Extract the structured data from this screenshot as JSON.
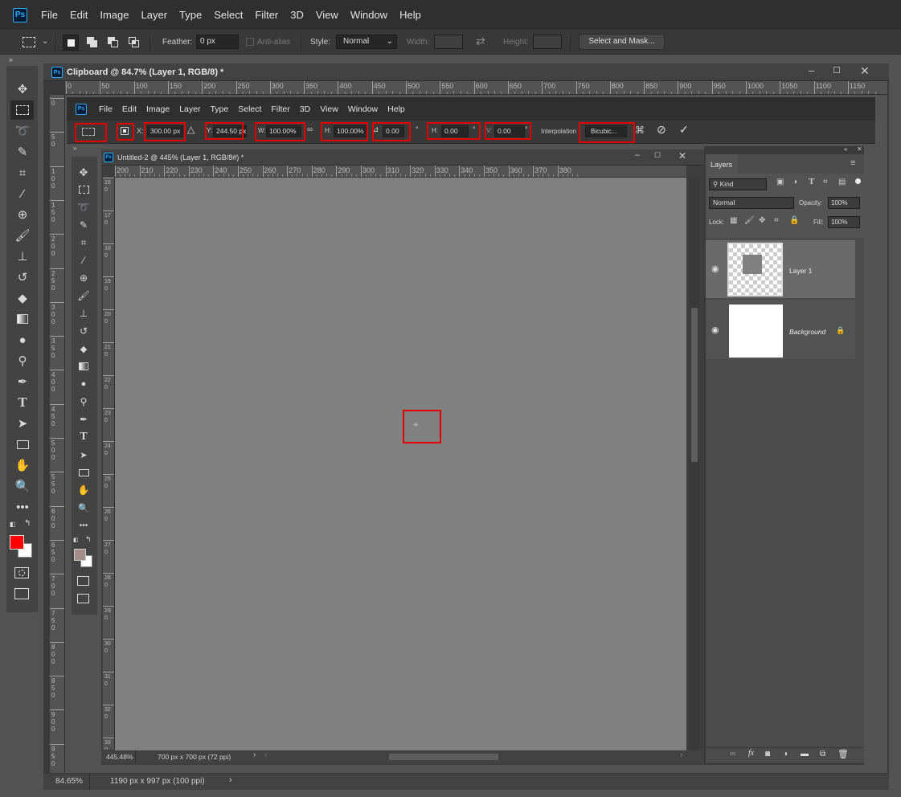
{
  "app": {
    "logo": "Ps"
  },
  "main_menu": [
    "File",
    "Edit",
    "Image",
    "Layer",
    "Type",
    "Select",
    "Filter",
    "3D",
    "View",
    "Window",
    "Help"
  ],
  "options": {
    "feather_label": "Feather:",
    "feather_value": "0 px",
    "antialias_label": "Anti-alias",
    "style_label": "Style:",
    "style_value": "Normal",
    "width_label": "Width:",
    "height_label": "Height:",
    "select_mask_label": "Select and Mask..."
  },
  "outer_doc": {
    "title": "Clipboard @ 84.7% (Layer 1, RGB/8) *",
    "ruler_ticks": [
      "0",
      "50",
      "100",
      "150",
      "200",
      "250",
      "300",
      "350",
      "400",
      "450",
      "500",
      "550",
      "600",
      "650",
      "700",
      "750",
      "800",
      "850",
      "900",
      "950",
      "1000",
      "1050",
      "1100",
      "1150"
    ],
    "vruler_ticks": [
      "0",
      "50",
      "100",
      "150",
      "200",
      "250",
      "300",
      "350",
      "400",
      "450",
      "500",
      "550",
      "600",
      "650",
      "700",
      "750",
      "800",
      "850",
      "900",
      "950"
    ],
    "zoom": "84.65%",
    "doc_info": "1190 px x 997 px (100 ppi)"
  },
  "inner_menu": [
    "File",
    "Edit",
    "Image",
    "Layer",
    "Type",
    "Select",
    "Filter",
    "3D",
    "View",
    "Window",
    "Help"
  ],
  "transform": {
    "x_label": "X:",
    "x_value": "300.00 px",
    "y_label": "Y:",
    "y_value": "244.50 px",
    "w_label": "W:",
    "w_value": "100.00%",
    "h_label": "H:",
    "h_value": "100.00%",
    "angle_value": "0.00",
    "deg": "°",
    "hskew_label": "H:",
    "hskew_value": "0.00",
    "vskew_label": "V:",
    "vskew_value": "0.00",
    "interp_label": "Interpolation",
    "interp_value": "Bicubic..."
  },
  "inner_doc": {
    "title": "Untitled-2 @ 445% (Layer 1, RGB/8#) *",
    "ruler_ticks": [
      "200",
      "210",
      "220",
      "230",
      "240",
      "250",
      "260",
      "270",
      "280",
      "290",
      "300",
      "310",
      "320",
      "330",
      "340",
      "350",
      "360",
      "370",
      "380"
    ],
    "vruler_ticks": [
      "160",
      "170",
      "180",
      "190",
      "200",
      "210",
      "220",
      "230",
      "240",
      "250",
      "260",
      "270",
      "280",
      "290",
      "300",
      "310",
      "320",
      "330"
    ],
    "zoom": "445.48%",
    "doc_info": "700 px x 700 px (72 ppi)"
  },
  "layers_panel": {
    "tab": "Layers",
    "kind": "Kind",
    "blend": "Normal",
    "opacity_label": "Opacity:",
    "opacity_value": "100%",
    "lock_label": "Lock:",
    "fill_label": "Fill:",
    "fill_value": "100%",
    "layers": [
      {
        "name": "Layer 1"
      },
      {
        "name": "Background"
      }
    ],
    "footer_fx": "fx"
  },
  "colors": {
    "foreground": "#ff0000",
    "background": "#ffffff",
    "inner_foreground": "#a58e86",
    "highlight": "#e50000"
  }
}
